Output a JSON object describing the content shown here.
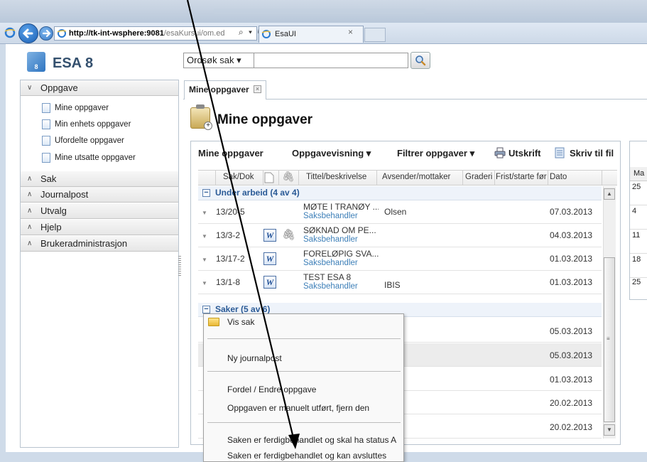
{
  "browser": {
    "url_host": "http://tk-int-wsphere:9081",
    "url_rest": "/esaKursui/om.ed",
    "tab_title": "EsaUI",
    "tab_close": "×"
  },
  "app": {
    "logo_digit": "8",
    "logo_text": "ESA 8"
  },
  "search": {
    "select_value": "Ordsøk sak ▾"
  },
  "sidebar": {
    "sections": [
      {
        "label": "Oppgave",
        "chevron": "∨"
      },
      {
        "label": "Sak",
        "chevron": "∧"
      },
      {
        "label": "Journalpost",
        "chevron": "∧"
      },
      {
        "label": "Utvalg",
        "chevron": "∧"
      },
      {
        "label": "Hjelp",
        "chevron": "∧"
      },
      {
        "label": "Brukeradministrasjon",
        "chevron": "∧"
      }
    ],
    "oppgave_items": [
      {
        "label": "Mine oppgaver"
      },
      {
        "label": "Min enhets oppgaver"
      },
      {
        "label": "Ufordelte oppgaver"
      },
      {
        "label": "Mine utsatte oppgaver"
      }
    ]
  },
  "main": {
    "tab_label": "Mine oppgaver",
    "tab_close": "×",
    "page_title": "Mine oppgaver",
    "toolbar": {
      "title": "Mine oppgaver",
      "view": "Oppgavevisning ▾",
      "filter": "Filtrer oppgaver ▾",
      "print": "Utskrift",
      "export": "Skriv til fil"
    },
    "columns": [
      "Sak/Dok",
      "Tittel/beskrivelse",
      "Avsender/mottaker",
      "Graderi",
      "Frist/starte før",
      "Dato"
    ],
    "groups": [
      {
        "label": "Under arbeid (4 av 4)",
        "icon": "−"
      },
      {
        "label": "Saker (5 av 6)",
        "icon": "−"
      }
    ],
    "rows_under_arbeid": [
      {
        "saknr": "13/20-5",
        "title": "MØTE I TRANØY ...",
        "role": "Saksbehandler",
        "sender": "Olsen",
        "date": "07.03.2013",
        "word": false,
        "clip": false
      },
      {
        "saknr": "13/3-2",
        "title": "SØKNAD OM PE...",
        "role": "Saksbehandler",
        "sender": "",
        "date": "04.03.2013",
        "word": true,
        "clip": true
      },
      {
        "saknr": "13/17-2",
        "title": "FORELØPIG SVA...",
        "role": "Saksbehandler",
        "sender": "",
        "date": "01.03.2013",
        "word": true,
        "clip": false
      },
      {
        "saknr": "13/1-8",
        "title": "TEST ESA 8",
        "role": "Saksbehandler",
        "sender": "IBIS",
        "date": "01.03.2013",
        "word": true,
        "clip": false
      }
    ],
    "rows_saker": [
      {
        "date": "05.03.2013"
      },
      {
        "date": "05.03.2013"
      },
      {
        "date": "01.03.2013"
      },
      {
        "date": "20.02.2013"
      },
      {
        "date": "20.02.2013"
      }
    ]
  },
  "calendar": {
    "header": "Ma",
    "days": [
      "25",
      "4",
      "11",
      "18",
      "25"
    ]
  },
  "context_menu": {
    "items": [
      {
        "label": "Vis sak"
      },
      {
        "label": "Ny journalpost"
      },
      {
        "label": "Fordel / Endre oppgave"
      },
      {
        "label": "Oppgaven er manuelt utført, fjern den"
      },
      {
        "label": "Saken er ferdigbehandlet og skal ha status A"
      },
      {
        "label": "Saken er ferdigbehandlet og kan avsluttes"
      }
    ]
  },
  "colors": {
    "accent_blue": "#2a5a96",
    "link_blue": "#3d7fb8",
    "frame_blue": "#cfdbe9"
  }
}
